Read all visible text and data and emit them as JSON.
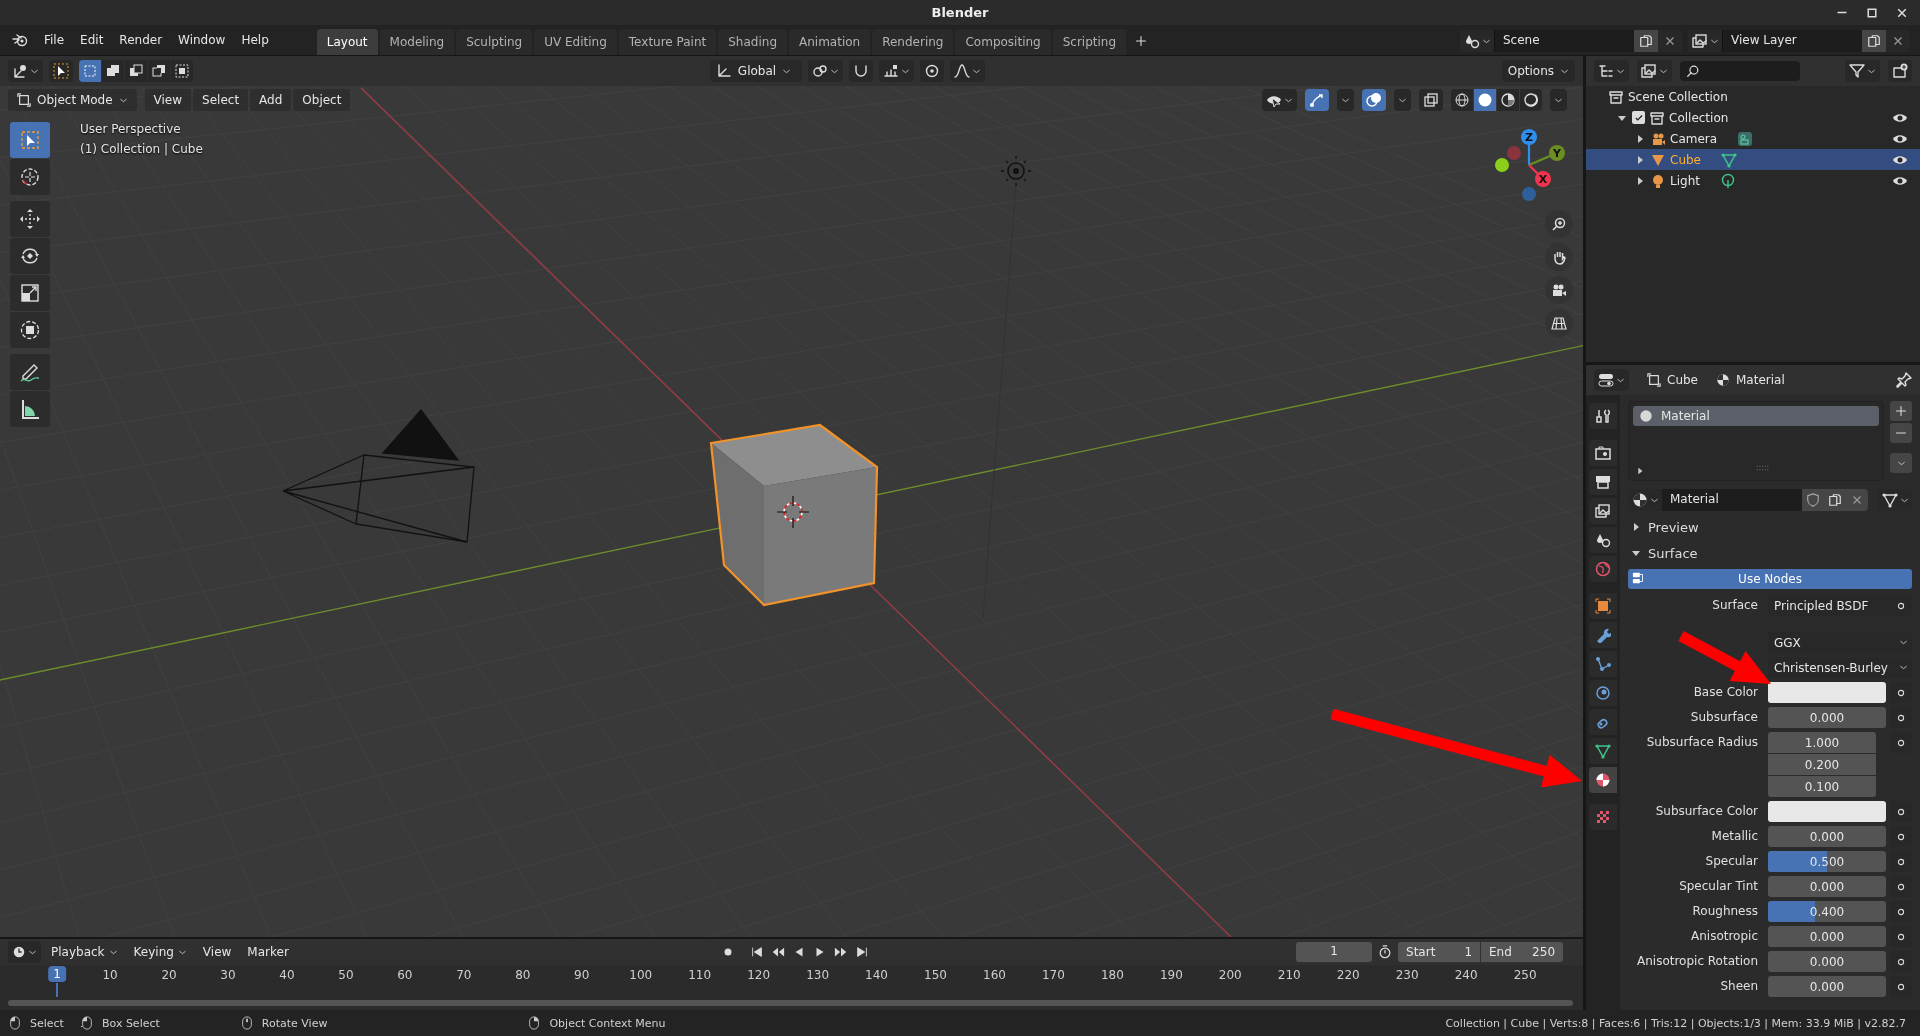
{
  "window": {
    "title": "Blender"
  },
  "menu": [
    "File",
    "Edit",
    "Render",
    "Window",
    "Help"
  ],
  "workspace_tabs": [
    {
      "label": "Layout",
      "selected": true
    },
    {
      "label": "Modeling",
      "selected": false
    },
    {
      "label": "Sculpting",
      "selected": false
    },
    {
      "label": "UV Editing",
      "selected": false
    },
    {
      "label": "Texture Paint",
      "selected": false
    },
    {
      "label": "Shading",
      "selected": false
    },
    {
      "label": "Animation",
      "selected": false
    },
    {
      "label": "Rendering",
      "selected": false
    },
    {
      "label": "Compositing",
      "selected": false
    },
    {
      "label": "Scripting",
      "selected": false
    }
  ],
  "scene": "Scene",
  "view_layer": "View Layer",
  "tool_header": {
    "select_modes": [
      {
        "kind": "set",
        "selected": true
      },
      {
        "kind": "extend",
        "selected": false
      },
      {
        "kind": "subtract",
        "selected": false
      },
      {
        "kind": "difference",
        "selected": false
      },
      {
        "kind": "intersect",
        "selected": false
      }
    ],
    "orientation": "Global",
    "options": "Options"
  },
  "viewport_header": {
    "mode": "Object Mode",
    "menus": [
      "View",
      "Select",
      "Add",
      "Object"
    ],
    "shading_modes": [
      {
        "kind": "wireframe",
        "selected": false
      },
      {
        "kind": "solid",
        "selected": true
      },
      {
        "kind": "material",
        "selected": false
      },
      {
        "kind": "rendered",
        "selected": false
      }
    ]
  },
  "viewport": {
    "info": [
      "User Perspective",
      "(1) Collection | Cube"
    ],
    "tools": [
      {
        "kind": "select",
        "selected": true
      },
      {
        "kind": "cursor",
        "selected": false
      },
      {
        "kind": "move",
        "selected": false
      },
      {
        "kind": "rotate",
        "selected": false
      },
      {
        "kind": "scale",
        "selected": false
      },
      {
        "kind": "transform",
        "selected": false
      },
      {
        "kind": "annotate",
        "selected": false
      },
      {
        "kind": "measure",
        "selected": false
      }
    ],
    "gizmo_axes": [
      {
        "label": "Z",
        "color": "#2f8ff0"
      },
      {
        "label": "Y",
        "color": "#6b8e23"
      },
      {
        "label": "X",
        "color": "#f0344f"
      }
    ]
  },
  "outliner": {
    "root": "Scene Collection",
    "collections": [
      {
        "label": "Collection",
        "checked": true,
        "expanded": true,
        "children": [
          {
            "label": "Camera",
            "kind": "camera",
            "expanded": false,
            "selected": false
          },
          {
            "label": "Cube",
            "kind": "mesh",
            "expanded": false,
            "selected": true
          },
          {
            "label": "Light",
            "kind": "light",
            "expanded": false,
            "selected": false
          }
        ]
      }
    ]
  },
  "properties": {
    "context": [
      {
        "kind": "object",
        "label": "Cube"
      },
      {
        "kind": "material",
        "label": "Material"
      }
    ],
    "tabs": [
      {
        "kind": "tool",
        "selected": false
      },
      {
        "kind": "render",
        "selected": false
      },
      {
        "kind": "output",
        "selected": false
      },
      {
        "kind": "view_layer",
        "selected": false
      },
      {
        "kind": "scene",
        "selected": false
      },
      {
        "kind": "world",
        "selected": false
      },
      {
        "kind": "object",
        "selected": false
      },
      {
        "kind": "modifiers",
        "selected": false
      },
      {
        "kind": "particles",
        "selected": false
      },
      {
        "kind": "physics",
        "selected": false
      },
      {
        "kind": "constraints",
        "selected": false
      },
      {
        "kind": "data",
        "selected": false
      },
      {
        "kind": "material",
        "selected": true
      },
      {
        "kind": "texture",
        "selected": false
      }
    ],
    "slots": [
      {
        "label": "Material",
        "selected": true
      }
    ],
    "material": "Material",
    "panels": [
      {
        "label": "Preview",
        "expanded": false
      },
      {
        "label": "Surface",
        "expanded": true
      }
    ],
    "use_nodes": "Use Nodes",
    "fields": [
      {
        "kind": "socket",
        "label": "Surface",
        "value": "Principled BSDF"
      },
      {
        "kind": "dropdown",
        "value": "GGX"
      },
      {
        "kind": "dropdown",
        "value": "Christensen-Burley"
      },
      {
        "kind": "color",
        "label": "Base Color",
        "color": "#e8e8e8"
      },
      {
        "kind": "slider",
        "label": "Subsurface",
        "value": "0.000",
        "level": 0
      },
      {
        "kind": "vector",
        "label": "Subsurface Radius",
        "values": [
          "1.000",
          "0.200",
          "0.100"
        ]
      },
      {
        "kind": "color",
        "label": "Subsurface Color",
        "color": "#e8e8e8"
      },
      {
        "kind": "slider",
        "label": "Metallic",
        "value": "0.000",
        "level": 0
      },
      {
        "kind": "slider",
        "label": "Specular",
        "value": "0.500",
        "level": 0.5
      },
      {
        "kind": "slider",
        "label": "Specular Tint",
        "value": "0.000",
        "level": 0
      },
      {
        "kind": "slider",
        "label": "Roughness",
        "value": "0.400",
        "level": 0.4
      },
      {
        "kind": "slider",
        "label": "Anisotropic",
        "value": "0.000",
        "level": 0
      },
      {
        "kind": "slider",
        "label": "Anisotropic Rotation",
        "value": "0.000",
        "level": 0
      },
      {
        "kind": "slider",
        "label": "Sheen",
        "value": "0.000",
        "level": 0
      }
    ]
  },
  "timeline": {
    "menus": [
      {
        "kind": "dropdown",
        "label": "Playback"
      },
      {
        "kind": "dropdown",
        "label": "Keying"
      },
      {
        "kind": "menu",
        "label": "View"
      },
      {
        "kind": "menu",
        "label": "Marker"
      }
    ],
    "current_frame": "1",
    "start_label": "Start",
    "start": "1",
    "end_label": "End",
    "end": "250",
    "playhead": "1",
    "ruler": [
      "10",
      "20",
      "30",
      "40",
      "50",
      "60",
      "70",
      "80",
      "90",
      "100",
      "110",
      "120",
      "130",
      "140",
      "150",
      "160",
      "170",
      "180",
      "190",
      "200",
      "210",
      "220",
      "230",
      "240",
      "250"
    ]
  },
  "status_bar": {
    "hints": [
      {
        "kind": "left",
        "label": "Select"
      },
      {
        "kind": "drag",
        "label": "Box Select"
      },
      {
        "kind": "middle",
        "label": "Rotate View"
      },
      {
        "kind": "right",
        "label": "Object Context Menu"
      }
    ],
    "stats": "Collection | Cube | Verts:8 | Faces:6 | Tris:12 | Objects:1/3 | Mem: 33.9 MiB | v2.82.7"
  }
}
